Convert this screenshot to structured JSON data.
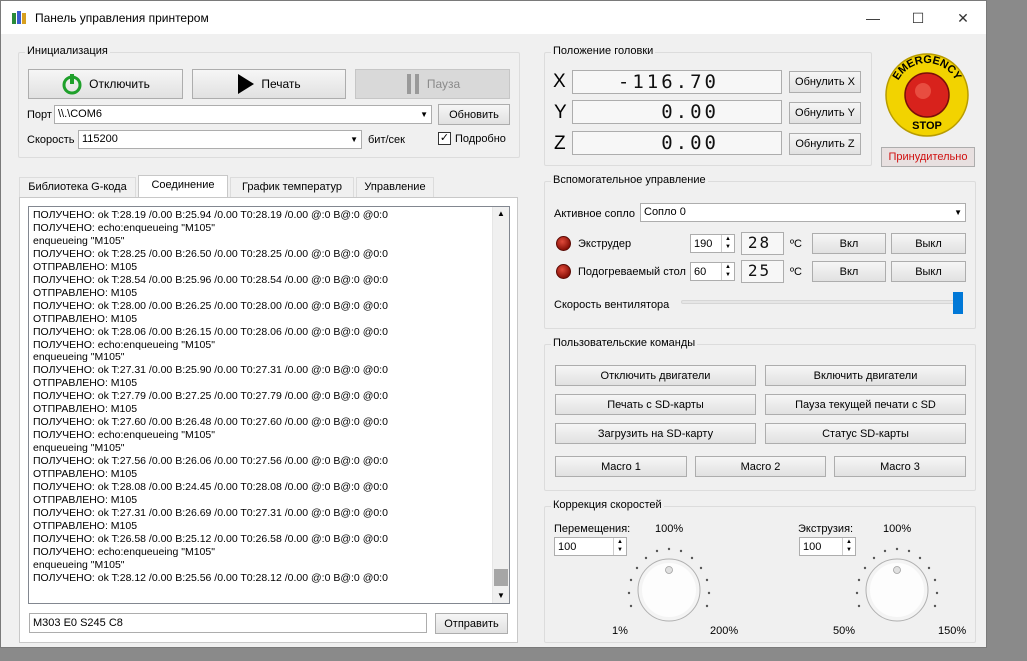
{
  "window": {
    "title": "Панель управления принтером",
    "minimize": "—",
    "maximize": "☐",
    "close": "✕"
  },
  "init": {
    "group_title": "Инициализация",
    "disconnect_label": "Отключить",
    "print_label": "Печать",
    "pause_label": "Пауза",
    "port_label": "Порт",
    "port_value": "\\\\.\\COM6",
    "refresh_label": "Обновить",
    "speed_label": "Скорость",
    "speed_value": "115200",
    "speed_unit": "бит/сек",
    "verbose_label": "Подробно",
    "verbose_checked": true
  },
  "head": {
    "group_title": "Положение головки",
    "axes": [
      {
        "name": "X",
        "value": "-116.70",
        "reset_label": "Обнулить X"
      },
      {
        "name": "Y",
        "value": "0.00",
        "reset_label": "Обнулить Y"
      },
      {
        "name": "Z",
        "value": "0.00",
        "reset_label": "Обнулить Z"
      }
    ]
  },
  "emergency": {
    "top_text": "EMERGENCY",
    "bottom_text": "STOP",
    "force_label": "Принудительно"
  },
  "tabs": [
    {
      "label": "Библиотека G-кода",
      "active": false
    },
    {
      "label": "Соединение",
      "active": true
    },
    {
      "label": "График температур",
      "active": false
    },
    {
      "label": "Управление",
      "active": false
    }
  ],
  "log": {
    "lines": [
      "ПОЛУЧЕНО: ok T:28.19 /0.00 B:25.94 /0.00 T0:28.19 /0.00 @:0 B@:0 @0:0",
      "ПОЛУЧЕНО: echo:enqueueing \"M105\"",
      "enqueueing \"M105\"",
      "ПОЛУЧЕНО: ok T:28.25 /0.00 B:26.50 /0.00 T0:28.25 /0.00 @:0 B@:0 @0:0",
      "ОТПРАВЛЕНО: M105",
      "ПОЛУЧЕНО: ok T:28.54 /0.00 B:25.96 /0.00 T0:28.54 /0.00 @:0 B@:0 @0:0",
      "ОТПРАВЛЕНО: M105",
      "ПОЛУЧЕНО: ok T:28.00 /0.00 B:26.25 /0.00 T0:28.00 /0.00 @:0 B@:0 @0:0",
      "ОТПРАВЛЕНО: M105",
      "ПОЛУЧЕНО: ok T:28.06 /0.00 B:26.15 /0.00 T0:28.06 /0.00 @:0 B@:0 @0:0",
      "ПОЛУЧЕНО: echo:enqueueing \"M105\"",
      "enqueueing \"M105\"",
      "ПОЛУЧЕНО: ok T:27.31 /0.00 B:25.90 /0.00 T0:27.31 /0.00 @:0 B@:0 @0:0",
      "ОТПРАВЛЕНО: M105",
      "ПОЛУЧЕНО: ok T:27.79 /0.00 B:27.25 /0.00 T0:27.79 /0.00 @:0 B@:0 @0:0",
      "ОТПРАВЛЕНО: M105",
      "ПОЛУЧЕНО: ok T:27.60 /0.00 B:26.48 /0.00 T0:27.60 /0.00 @:0 B@:0 @0:0",
      "ПОЛУЧЕНО: echo:enqueueing \"M105\"",
      "enqueueing \"M105\"",
      "ПОЛУЧЕНО: ok T:27.56 /0.00 B:26.06 /0.00 T0:27.56 /0.00 @:0 B@:0 @0:0",
      "ОТПРАВЛЕНО: M105",
      "ПОЛУЧЕНО: ok T:28.08 /0.00 B:24.45 /0.00 T0:28.08 /0.00 @:0 B@:0 @0:0",
      "ОТПРАВЛЕНО: M105",
      "ПОЛУЧЕНО: ok T:27.31 /0.00 B:26.69 /0.00 T0:27.31 /0.00 @:0 B@:0 @0:0",
      "ОТПРАВЛЕНО: M105",
      "ПОЛУЧЕНО: ok T:26.58 /0.00 B:25.12 /0.00 T0:26.58 /0.00 @:0 B@:0 @0:0",
      "ПОЛУЧЕНО: echo:enqueueing \"M105\"",
      "enqueueing \"M105\"",
      "ПОЛУЧЕНО: ok T:28.12 /0.00 B:25.56 /0.00 T0:28.12 /0.00 @:0 B@:0 @0:0"
    ],
    "command_value": "M303 E0 S245 C8",
    "send_label": "Отправить"
  },
  "aux": {
    "group_title": "Вспомогательное управление",
    "active_nozzle_label": "Активное сопло",
    "active_nozzle_value": "Сопло 0",
    "extruder": {
      "label": "Экструдер",
      "target": "190",
      "current": "28",
      "unit": "ºC",
      "on_label": "Вкл",
      "off_label": "Выкл"
    },
    "bed": {
      "label": "Подогреваемый стол",
      "target": "60",
      "current": "25",
      "unit": "ºC",
      "on_label": "Вкл",
      "off_label": "Выкл"
    },
    "fan_label": "Скорость вентилятора",
    "fan_level": 1.0
  },
  "custom": {
    "group_title": "Пользовательские команды",
    "buttons": [
      "Отключить двигатели",
      "Включить двигатели",
      "Печать с SD-карты",
      "Пауза текущей печати с SD",
      "Загрузить на SD-карту",
      "Статус SD-карты"
    ],
    "macros": [
      "Macro 1",
      "Macro 2",
      "Macro 3"
    ]
  },
  "speed": {
    "group_title": "Коррекция скоростей",
    "move": {
      "label": "Перемещения:",
      "value": "100",
      "pct_top": "100%",
      "pct_min": "1%",
      "pct_max": "200%"
    },
    "extrude": {
      "label": "Экструзия:",
      "value": "100",
      "pct_top": "100%",
      "pct_min": "50%",
      "pct_max": "150%"
    }
  },
  "colors": {
    "accent": "#0078d7",
    "emergency_red": "#d8221c",
    "emergency_yellow": "#f2d300",
    "force_red": "#d01010"
  }
}
